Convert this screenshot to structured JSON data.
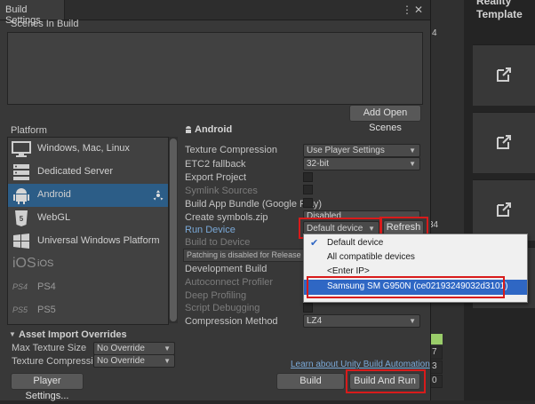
{
  "window": {
    "title": "Build Settings",
    "menu_icon": "kebab-icon",
    "close_icon": "close-icon"
  },
  "scenes": {
    "label": "Scenes In Build",
    "add_button": "Add Open Scenes"
  },
  "platform": {
    "label": "Platform",
    "items": [
      {
        "label": "Windows, Mac, Linux",
        "icon": "monitor-icon"
      },
      {
        "label": "Dedicated Server",
        "icon": "server-icon"
      },
      {
        "label": "Android",
        "icon": "android-icon",
        "selected": true,
        "badge_icon": "unity-target-icon"
      },
      {
        "label": "WebGL",
        "icon": "html5-icon"
      },
      {
        "label": "Universal Windows Platform",
        "icon": "windows-icon"
      },
      {
        "label": "iOS",
        "icon": "ios-text-icon"
      },
      {
        "label": "PS4",
        "icon": "ps4-text-icon"
      },
      {
        "label": "PS5",
        "icon": "ps5-text-icon"
      }
    ]
  },
  "android": {
    "heading": "Android",
    "rows": {
      "texture_compression": {
        "label": "Texture Compression",
        "value": "Use Player Settings"
      },
      "etc2_fallback": {
        "label": "ETC2 fallback",
        "value": "32-bit"
      },
      "export_project": {
        "label": "Export Project"
      },
      "symlink_sources": {
        "label": "Symlink Sources"
      },
      "build_app_bundle": {
        "label": "Build App Bundle (Google Play)"
      },
      "create_symbols": {
        "label": "Create symbols.zip",
        "value": "Disabled"
      },
      "run_device": {
        "label": "Run Device",
        "value": "Default device",
        "refresh": "Refresh"
      },
      "build_to_device": {
        "label": "Build to Device"
      },
      "patching_note": "Patching is disabled for Release build",
      "development_build": {
        "label": "Development Build"
      },
      "autoconnect_profiler": {
        "label": "Autoconnect Profiler"
      },
      "deep_profiling": {
        "label": "Deep Profiling"
      },
      "script_debugging": {
        "label": "Script Debugging"
      },
      "compression_method": {
        "label": "Compression Method",
        "value": "LZ4"
      }
    }
  },
  "device_menu": {
    "items": [
      "Default device",
      "All compatible devices",
      "<Enter IP>",
      "Samsung SM G950N (ce02193249032d3101)"
    ],
    "checked_index": 0,
    "highlighted_index": 3
  },
  "asset_import": {
    "label": "Asset Import Overrides",
    "max_texture_size": {
      "label": "Max Texture Size",
      "value": "No Override"
    },
    "texture_compression": {
      "label": "Texture Compression",
      "value": "No Override"
    }
  },
  "footer": {
    "learn_link": "Learn about Unity Build Automation",
    "player_settings": "Player Settings...",
    "build": "Build",
    "build_and_run": "Build And Run"
  },
  "background": {
    "right_title": "Reality Template",
    "mid_values": [
      "4",
      "34",
      "7",
      "3",
      "0"
    ]
  },
  "colors": {
    "window_bg": "#383838",
    "selection": "#2c5d87",
    "highlight_box": "#d81b1b",
    "menu_highlight": "#2f67c4",
    "link": "#7aa9d8"
  }
}
